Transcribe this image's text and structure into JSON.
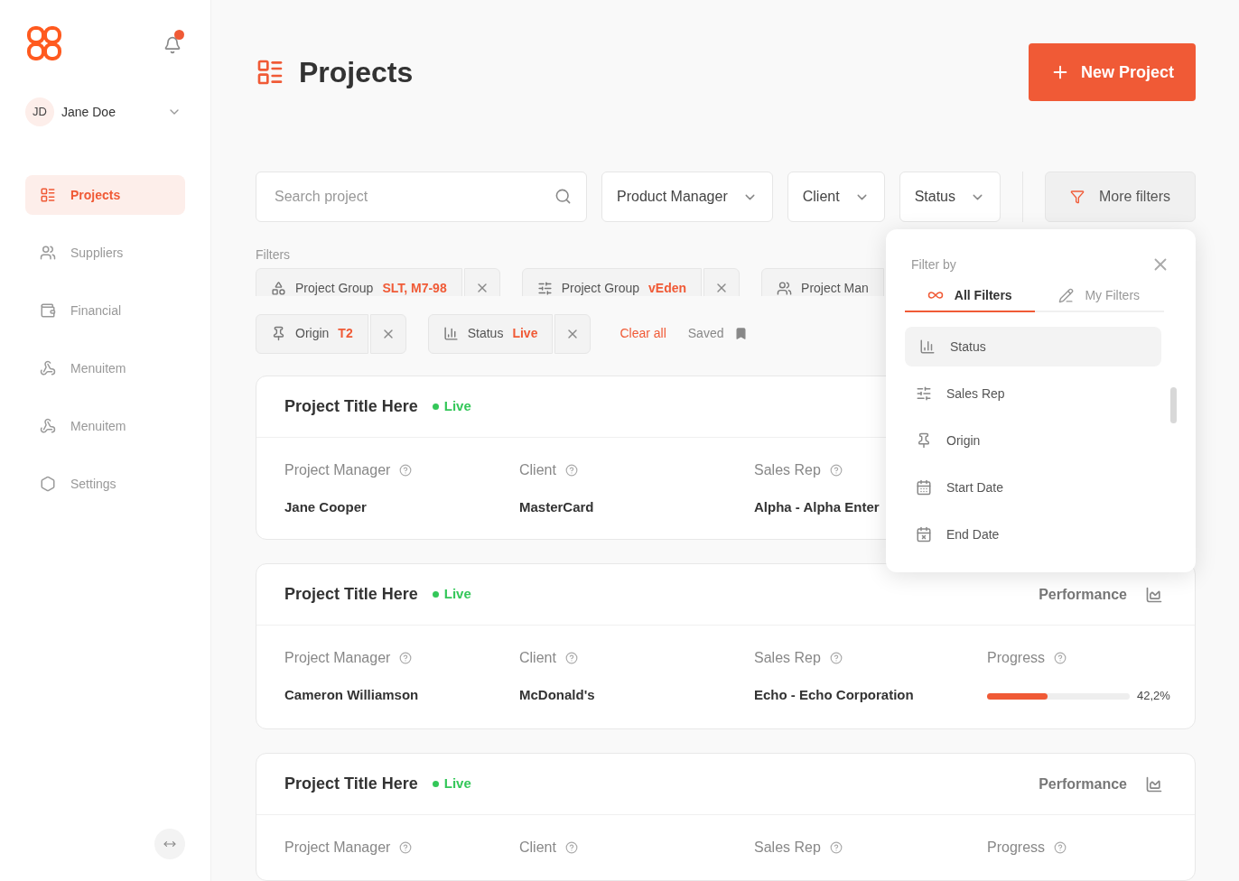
{
  "sidebar": {
    "has_notification": true,
    "user": {
      "initials": "JD",
      "name": "Jane Doe"
    },
    "items": [
      {
        "label": "Projects",
        "selected": true
      },
      {
        "label": "Suppliers",
        "selected": false
      },
      {
        "label": "Financial",
        "selected": false
      },
      {
        "label": "Menuitem",
        "selected": false
      },
      {
        "label": "Menuitem",
        "selected": false
      },
      {
        "label": "Settings",
        "selected": false
      }
    ]
  },
  "header": {
    "title": "Projects",
    "new_button": "New Project"
  },
  "toolbar": {
    "search": {
      "placeholder": "Search project"
    },
    "dropdowns": [
      "Product Manager",
      "Client",
      "Status"
    ],
    "more_filters": "More filters"
  },
  "filters": {
    "label": "Filters",
    "chips": [
      {
        "label": "Project Group",
        "value": "SLT, M7-98"
      },
      {
        "label": "Project Group",
        "value": "vEden"
      },
      {
        "label": "Project Man"
      },
      {
        "label": "Origin",
        "value": "T2"
      },
      {
        "label": "Status",
        "value": "Live"
      }
    ],
    "clear_all": "Clear all",
    "saved": "Saved"
  },
  "filter_popup": {
    "title": "Filter by",
    "tabs": [
      {
        "label": "All Filters",
        "selected": true
      },
      {
        "label": "My Filters",
        "selected": false
      }
    ],
    "items": [
      {
        "label": "Status",
        "selected": true
      },
      {
        "label": "Sales Rep",
        "selected": false
      },
      {
        "label": "Origin",
        "selected": false
      },
      {
        "label": "Start Date",
        "selected": false
      },
      {
        "label": "End Date",
        "selected": false
      }
    ]
  },
  "projects": [
    {
      "title": "Project Title Here",
      "status": "Live",
      "fields": [
        {
          "label": "Project Manager",
          "value": "Jane Cooper"
        },
        {
          "label": "Client",
          "value": "MasterCard"
        },
        {
          "label": "Sales Rep",
          "value": "Alpha - Alpha Enter"
        }
      ]
    },
    {
      "title": "Project Title Here",
      "status": "Live",
      "performance": "Performance",
      "fields": [
        {
          "label": "Project Manager",
          "value": "Cameron Williamson"
        },
        {
          "label": "Client",
          "value": "McDonald's"
        },
        {
          "label": "Sales Rep",
          "value": "Echo - Echo Corporation"
        }
      ],
      "progress": {
        "label": "Progress",
        "level": 0.422,
        "reading": "42,2%"
      }
    },
    {
      "title": "Project Title Here",
      "status": "Live",
      "performance": "Performance",
      "fields": [
        {
          "label": "Project Manager"
        },
        {
          "label": "Client"
        },
        {
          "label": "Sales Rep"
        }
      ],
      "progress": {
        "label": "Progress"
      }
    }
  ]
}
